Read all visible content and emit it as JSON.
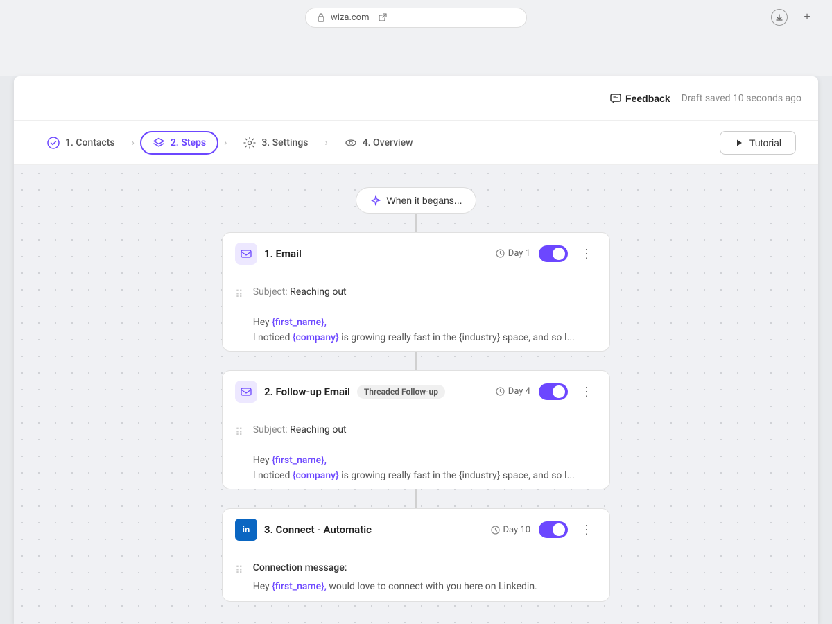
{
  "browser": {
    "url": "wiza.com",
    "lock_icon": "🔒",
    "link_icon": "🔗"
  },
  "topbar": {
    "feedback_label": "Feedback",
    "draft_status": "Draft saved 10 seconds ago"
  },
  "nav": {
    "steps": [
      {
        "id": "contacts",
        "number": "1",
        "label": "Contacts",
        "icon": "check-circle",
        "state": "completed"
      },
      {
        "id": "steps",
        "number": "2",
        "label": "Steps",
        "icon": "layers",
        "state": "active"
      },
      {
        "id": "settings",
        "number": "3",
        "label": "Settings",
        "icon": "gear",
        "state": "default"
      },
      {
        "id": "overview",
        "number": "4",
        "label": "Overview",
        "icon": "eye",
        "state": "default"
      }
    ],
    "tutorial_label": "Tutorial"
  },
  "workflow": {
    "trigger_label": "When it begans...",
    "steps": [
      {
        "id": "step1",
        "number": "1",
        "type": "Email",
        "icon_type": "email",
        "day": "Day 1",
        "enabled": true,
        "subject_label": "Subject:",
        "subject_value": "Reaching out",
        "body_line1_prefix": "Hey ",
        "body_line1_var": "{first_name},",
        "body_line2_prefix": "I noticed ",
        "body_line2_var": "{company}",
        "body_line2_suffix": " is growing really fast in the {industry} space, and so I..."
      },
      {
        "id": "step2",
        "number": "2",
        "type": "Follow-up Email",
        "icon_type": "email",
        "tag": "Threaded Follow-up",
        "day": "Day 4",
        "enabled": true,
        "subject_label": "Subject:",
        "subject_value": "Reaching out",
        "body_line1_prefix": "Hey ",
        "body_line1_var": "{first_name},",
        "body_line2_prefix": "I noticed ",
        "body_line2_var": "{company}",
        "body_line2_suffix": " is growing really fast in the {industry} space, and so I..."
      },
      {
        "id": "step3",
        "number": "3",
        "type": "Connect - Automatic",
        "icon_type": "linkedin",
        "day": "Day 10",
        "enabled": true,
        "connection_label": "Connection message:",
        "body_line1_prefix": "Hey ",
        "body_line1_var": "{first_name},",
        "body_line1_suffix": " would love to connect with you here on Linkedin."
      }
    ]
  }
}
